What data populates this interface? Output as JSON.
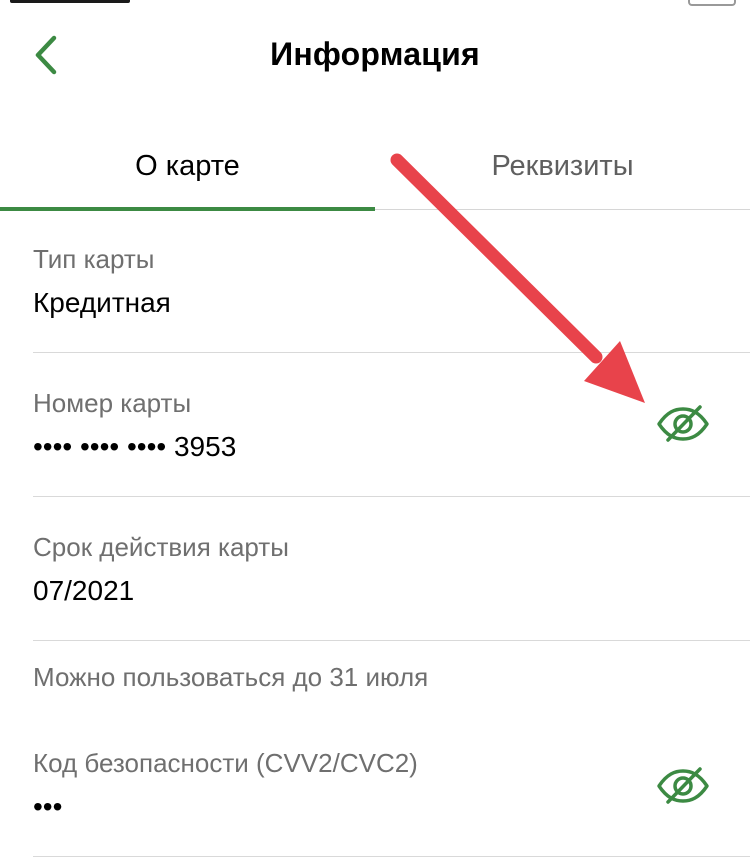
{
  "header": {
    "title": "Информация"
  },
  "tabs": [
    {
      "label": "О карте",
      "active": true
    },
    {
      "label": "Реквизиты",
      "active": false
    }
  ],
  "fields": {
    "card_type": {
      "label": "Тип карты",
      "value": "Кредитная"
    },
    "card_number": {
      "label": "Номер карты",
      "value": "•••• •••• •••• 3953"
    },
    "expiry": {
      "label": "Срок действия карты",
      "value": "07/2021"
    },
    "usable_note": "Можно пользоваться до 31 июля",
    "cvv": {
      "label": "Код безопасности (CVV2/CVC2)",
      "value": "•••"
    }
  },
  "icons": {
    "back": "chevron-left-icon",
    "visibility": "eye-off-icon"
  },
  "colors": {
    "accent_green": "#3c8a43",
    "annotation_arrow": "#e8434b",
    "label_gray": "#6f6f6f"
  }
}
